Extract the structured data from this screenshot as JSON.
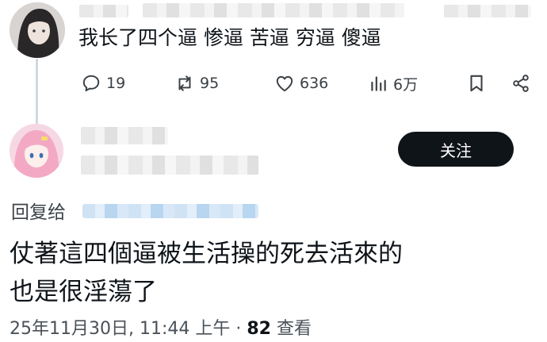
{
  "post": {
    "text": "我长了四个逼 惨逼 苦逼 穷逼 傻逼",
    "actions": {
      "replies": "19",
      "reposts": "95",
      "likes": "636",
      "views": "6万"
    }
  },
  "reply": {
    "follow_label": "关注",
    "reply_to_label": "回复给",
    "text_line1": "仗著這四個逼被生活操的死去活來的",
    "text_line2": "也是很淫蕩了",
    "timestamp": "25年11月30日, 11:44 上午 · ",
    "view_count": "82",
    "view_label": " 查看"
  },
  "colors": {
    "text": "#0f1419",
    "icon": "#3a3f44",
    "button_bg": "#0f1419",
    "thread_line": "#cfd9de"
  }
}
